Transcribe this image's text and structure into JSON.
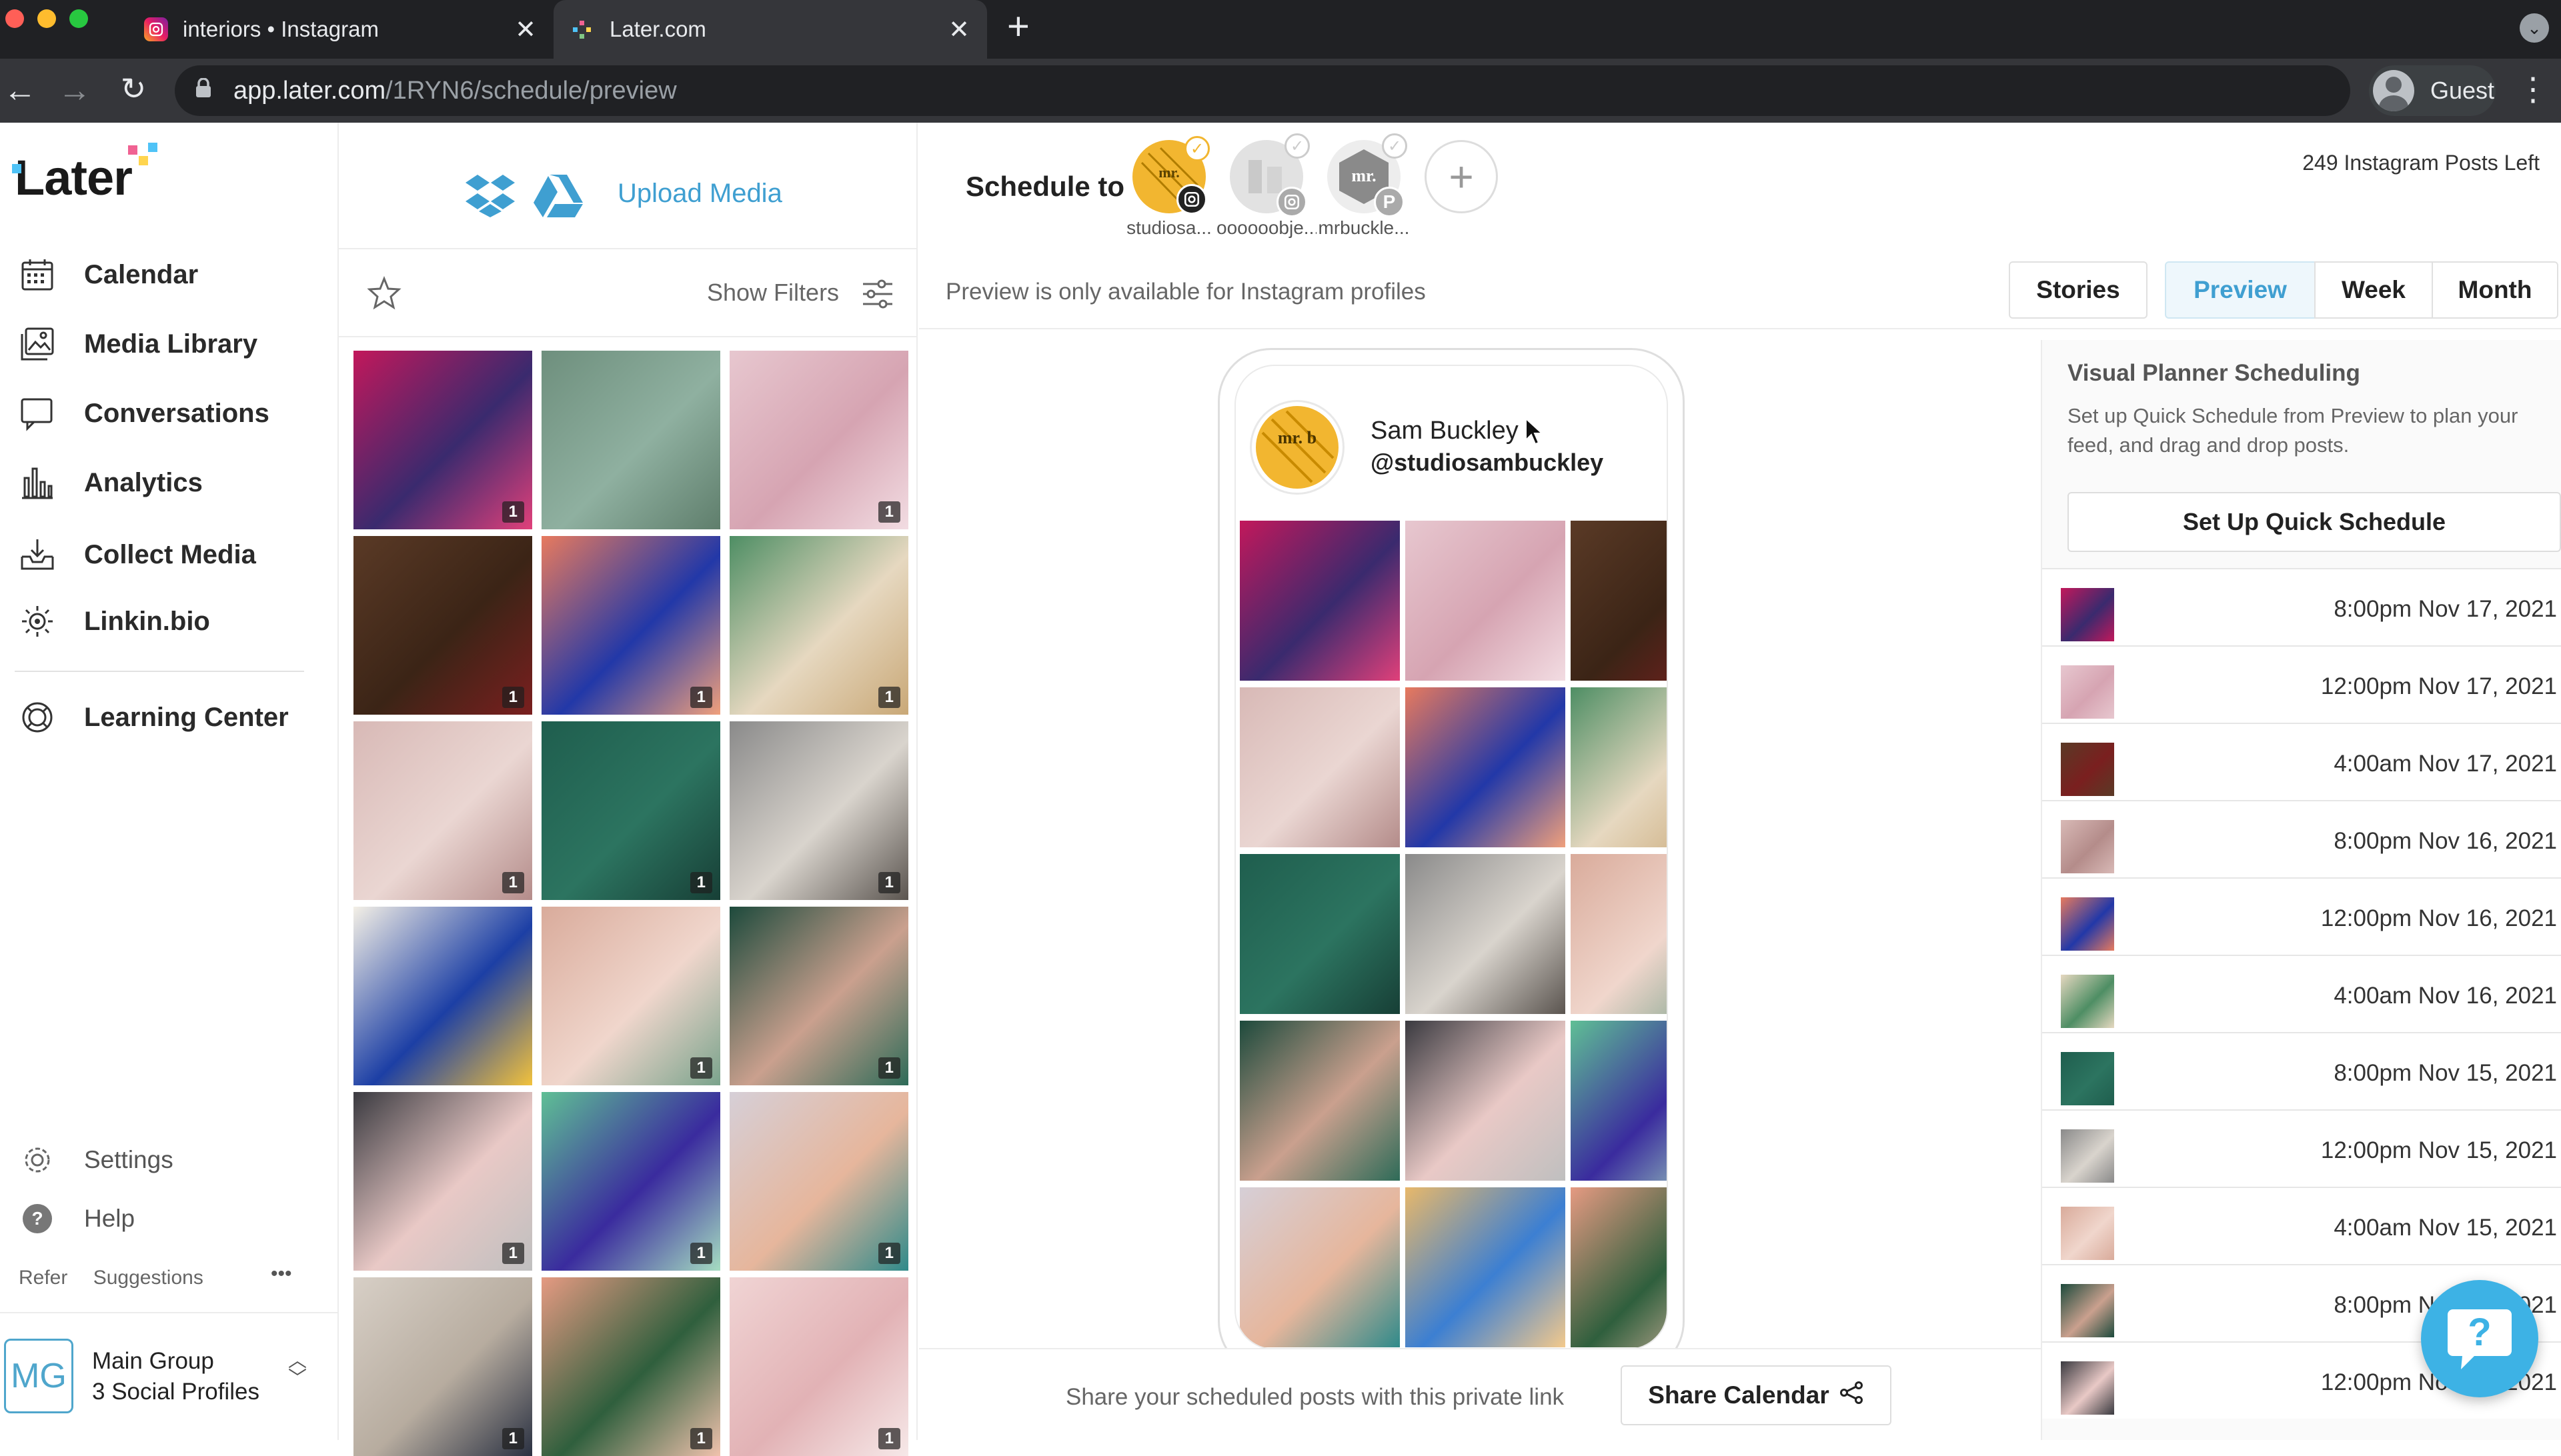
{
  "browser": {
    "tabs": [
      {
        "title": "interiors • Instagram",
        "active": false
      },
      {
        "title": "Later.com",
        "active": true
      }
    ],
    "url_host": "app.later.com",
    "url_path": "/1RYN6/schedule/preview",
    "profile_label": "Guest"
  },
  "sidebar": {
    "logo_text": "Later",
    "nav": [
      {
        "label": "Calendar",
        "icon": "calendar-icon"
      },
      {
        "label": "Media Library",
        "icon": "media-library-icon"
      },
      {
        "label": "Conversations",
        "icon": "conversations-icon"
      },
      {
        "label": "Analytics",
        "icon": "analytics-icon"
      },
      {
        "label": "Collect Media",
        "icon": "collect-media-icon"
      },
      {
        "label": "Linkin.bio",
        "icon": "linkin-bio-icon"
      },
      {
        "label": "Learning Center",
        "icon": "learning-center-icon"
      }
    ],
    "settings_label": "Settings",
    "help_label": "Help",
    "refer_label": "Refer",
    "suggestions_label": "Suggestions",
    "more_label": "•••",
    "workspace": {
      "badge": "MG",
      "name": "Main Group",
      "profiles": "3 Social Profiles"
    }
  },
  "media": {
    "upload_label": "Upload Media",
    "filters_label": "Show Filters",
    "thumbs": [
      {
        "colors": [
          "#c2185b",
          "#3a2a6e",
          "#e0407a"
        ],
        "count": "1"
      },
      {
        "colors": [
          "#6e8f7d",
          "#8fb0a0",
          "#5f7e6c"
        ],
        "count": ""
      },
      {
        "colors": [
          "#e7c7cf",
          "#d6a4b2",
          "#f2dce2"
        ],
        "count": "1"
      },
      {
        "colors": [
          "#5a3a26",
          "#3b2416",
          "#7a1f1f"
        ],
        "count": "1"
      },
      {
        "colors": [
          "#e77a5e",
          "#2238a8",
          "#f0a07c"
        ],
        "count": "1"
      },
      {
        "colors": [
          "#4e8e64",
          "#e6d8c0",
          "#c9a877"
        ],
        "count": "1"
      },
      {
        "colors": [
          "#d8b9b6",
          "#ead6d2",
          "#b48c8a"
        ],
        "count": "1"
      },
      {
        "colors": [
          "#1f5e4e",
          "#2c7460",
          "#173f36"
        ],
        "count": "1"
      },
      {
        "colors": [
          "#8a8a8a",
          "#d9d4cd",
          "#5b5550"
        ],
        "count": "1"
      },
      {
        "colors": [
          "#f4f0e6",
          "#1c3fa5",
          "#f2c23c"
        ],
        "count": ""
      },
      {
        "colors": [
          "#d9ab9b",
          "#f0d6cc",
          "#7aa38c"
        ],
        "count": "1"
      },
      {
        "colors": [
          "#1d4a3c",
          "#caa08e",
          "#2e6b58"
        ],
        "count": "1"
      },
      {
        "colors": [
          "#3a3a40",
          "#e9c9c6",
          "#bfbfbf"
        ],
        "count": "1"
      },
      {
        "colors": [
          "#5fbf95",
          "#3a2b9e",
          "#a5dcc1"
        ],
        "count": "1"
      },
      {
        "colors": [
          "#d6cfd7",
          "#e6b69c",
          "#2f8a8a"
        ],
        "count": "1"
      },
      {
        "colors": [
          "#d7cfc6",
          "#b7ac9f",
          "#2a3142"
        ],
        "count": "1"
      },
      {
        "colors": [
          "#e59a82",
          "#2f5f3d",
          "#f0c2ad"
        ],
        "count": "1"
      },
      {
        "colors": [
          "#f0d4d4",
          "#e2b2b5",
          "#f6e8e8"
        ],
        "count": "1"
      }
    ]
  },
  "schedule": {
    "label": "Schedule to",
    "profiles": [
      {
        "name": "studiosa...",
        "ring": "#f2b630",
        "network": "instagram"
      },
      {
        "name": "oooooobje...",
        "ring": "#c8c8c8",
        "network": "instagram"
      },
      {
        "name": "mrbuckle...",
        "ring": "#cfcfcf",
        "network": "pinterest"
      }
    ],
    "add_label": "+",
    "posts_left": "249 Instagram Posts Left"
  },
  "views": {
    "note": "Preview is only available for Instagram profiles",
    "buttons": [
      {
        "label": "Stories",
        "active": false
      },
      {
        "label": "Preview",
        "active": true
      },
      {
        "label": "Week",
        "active": false
      },
      {
        "label": "Month",
        "active": false
      }
    ]
  },
  "phone": {
    "name": "Sam Buckley",
    "handle": "@studiosambuckley",
    "avatar_text": "mr. b",
    "grid": [
      [
        "#c2185b",
        "#3a2a6e",
        "#e0407a"
      ],
      [
        "#e7c7cf",
        "#d6a4b2",
        "#f2dce2"
      ],
      [
        "#5a3a26",
        "#3b2416",
        "#7a1f1f"
      ],
      [
        "#d8b9b6",
        "#ead6d2",
        "#b48c8a"
      ],
      [
        "#e77a5e",
        "#2238a8",
        "#f0a07c"
      ],
      [
        "#4e8e64",
        "#e6d8c0",
        "#c9a877"
      ],
      [
        "#1f5e4e",
        "#2c7460",
        "#173f36"
      ],
      [
        "#8a8a8a",
        "#d9d4cd",
        "#5b5550"
      ],
      [
        "#d9ab9b",
        "#f0d6cc",
        "#7aa38c"
      ],
      [
        "#1d4a3c",
        "#caa08e",
        "#2e6b58"
      ],
      [
        "#3a3a40",
        "#e9c9c6",
        "#bfbfbf"
      ],
      [
        "#5fbf95",
        "#3a2b9e",
        "#a5dcc1"
      ],
      [
        "#d6cfd7",
        "#e6b69c",
        "#2f8a8a"
      ],
      [
        "#e8b86a",
        "#3c7fd2",
        "#f3c98c"
      ],
      [
        "#e59a82",
        "#2f5f3d",
        "#f0c2ad"
      ]
    ]
  },
  "planner": {
    "title": "Visual Planner Scheduling",
    "description": "Set up Quick Schedule from Preview to plan your feed, and drag and drop posts.",
    "button": "Set Up Quick Schedule",
    "rows": [
      {
        "time": "8:00pm Nov 17, 2021",
        "colors": [
          "#c2185b",
          "#3a2a6e"
        ]
      },
      {
        "time": "12:00pm Nov 17, 2021",
        "colors": [
          "#e7c7cf",
          "#d6a4b2"
        ]
      },
      {
        "time": "4:00am Nov 17, 2021",
        "colors": [
          "#5a3a26",
          "#7a1f1f"
        ]
      },
      {
        "time": "8:00pm Nov 16, 2021",
        "colors": [
          "#d8b9b6",
          "#b48c8a"
        ]
      },
      {
        "time": "12:00pm Nov 16, 2021",
        "colors": [
          "#e77a5e",
          "#2238a8"
        ]
      },
      {
        "time": "4:00am Nov 16, 2021",
        "colors": [
          "#e6d8c0",
          "#4e8e64"
        ]
      },
      {
        "time": "8:00pm Nov 15, 2021",
        "colors": [
          "#1f5e4e",
          "#2c7460"
        ]
      },
      {
        "time": "12:00pm Nov 15, 2021",
        "colors": [
          "#8a8a8a",
          "#d9d4cd"
        ]
      },
      {
        "time": "4:00am Nov 15, 2021",
        "colors": [
          "#d9ab9b",
          "#f0d6cc"
        ]
      },
      {
        "time": "8:00pm Nov 14, 2021",
        "colors": [
          "#1d4a3c",
          "#caa08e"
        ]
      },
      {
        "time": "12:00pm Nov 14, 2021",
        "colors": [
          "#3a3a40",
          "#e9c9c6"
        ]
      }
    ]
  },
  "share": {
    "note": "Share your scheduled posts with this private link",
    "button": "Share Calendar"
  },
  "colors": {
    "accent": "#3f9fd1",
    "brand_yellow": "#f2b630",
    "help_fab": "#3db2e5"
  }
}
